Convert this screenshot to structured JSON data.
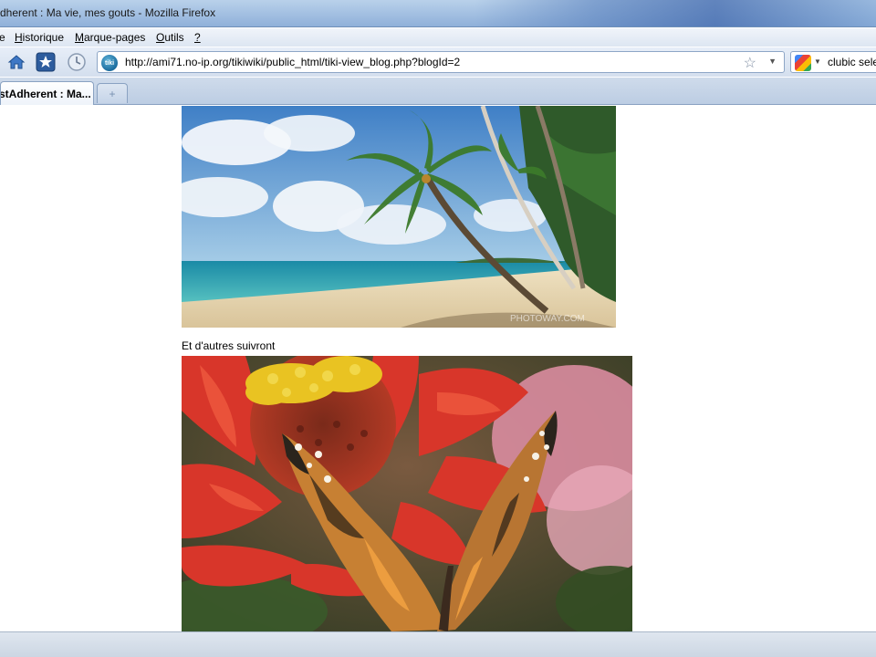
{
  "window": {
    "title": "dherent : Ma vie, mes gouts - Mozilla Firefox"
  },
  "menu": {
    "items": [
      "e",
      "Historique",
      "Marque-pages",
      "Outils",
      "?"
    ]
  },
  "navbar": {
    "url": "http://ami71.no-ip.org/tikiwiki/public_html/tiki-view_blog.php?blogId=2",
    "search_text": "clubic sele"
  },
  "tabs": {
    "active_label": "stAdherent : Ma...",
    "new_tab_label": "+"
  },
  "content": {
    "caption": "Et d'autres suivront",
    "watermark": "PHOTOWAY.COM"
  },
  "colors": {
    "accent": "#1b6c9e",
    "link": "#0000ee"
  }
}
